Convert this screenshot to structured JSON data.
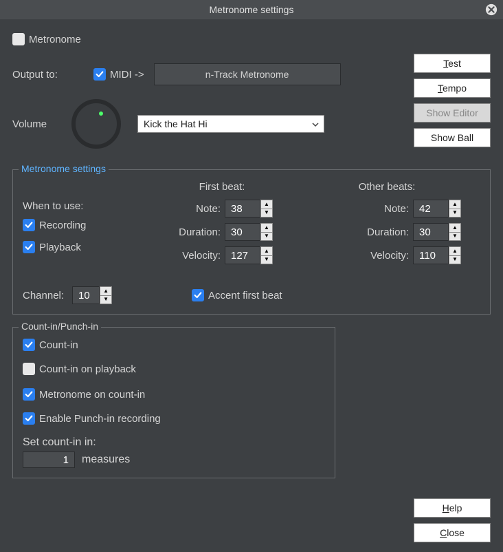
{
  "title": "Metronome settings",
  "metronome_cb": {
    "label": "Metronome",
    "checked": false
  },
  "output_label": "Output to:",
  "midi_cb": {
    "label": "MIDI ->",
    "checked": true
  },
  "metronome_device": "n-Track Metronome",
  "volume_label": "Volume",
  "preset_select": "Kick the Hat Hi",
  "buttons": {
    "test": "Test",
    "test_ul": "T",
    "tempo": "Tempo",
    "tempo_ul": "T",
    "show_editor": "Show Editor",
    "show_ball": "Show Ball",
    "help": "Help",
    "help_ul": "H",
    "close": "Close",
    "close_ul": "C"
  },
  "settings": {
    "legend": "Metronome settings",
    "when_label": "When to use:",
    "recording_cb": {
      "label": "Recording",
      "checked": true
    },
    "playback_cb": {
      "label": "Playback",
      "checked": true
    },
    "first_beat_label": "First beat:",
    "other_beats_label": "Other beats:",
    "note_label": "Note:",
    "duration_label": "Duration:",
    "velocity_label": "Velocity:",
    "first": {
      "note": "38",
      "duration": "30",
      "velocity": "127"
    },
    "other": {
      "note": "42",
      "duration": "30",
      "velocity": "110"
    },
    "channel_label": "Channel:",
    "channel_value": "10",
    "accent_cb": {
      "label": "Accent first beat",
      "checked": true
    }
  },
  "countin": {
    "legend": "Count-in/Punch-in",
    "countin_cb": {
      "label": "Count-in",
      "checked": true
    },
    "countin_playback_cb": {
      "label": "Count-in on playback",
      "checked": false
    },
    "metronome_countin_cb": {
      "label": "Metronome on count-in",
      "checked": true
    },
    "punchin_cb": {
      "label": "Enable Punch-in recording",
      "checked": true
    },
    "set_label": "Set count-in in:",
    "measures_value": "1",
    "measures_label": "measures"
  }
}
